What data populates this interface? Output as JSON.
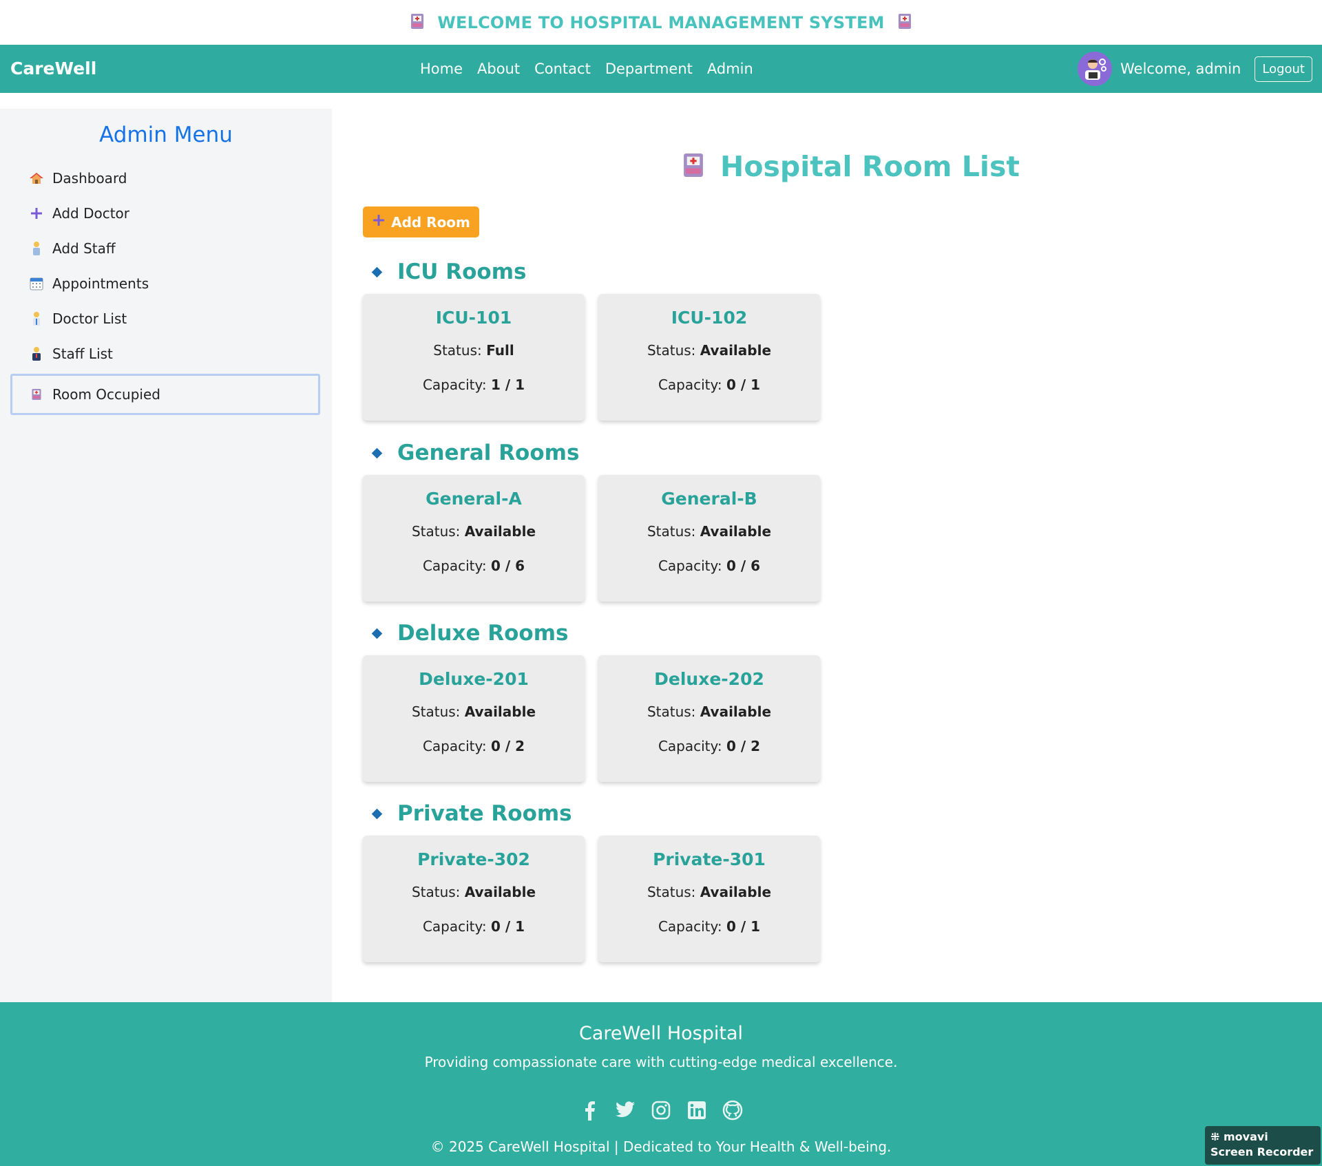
{
  "banner": {
    "text": "WELCOME TO HOSPITAL MANAGEMENT SYSTEM",
    "left_icon": "hospital-bed-icon",
    "right_icon": "hospital-bed-icon"
  },
  "navbar": {
    "brand": "CareWell",
    "links": [
      "Home",
      "About",
      "Contact",
      "Department",
      "Admin"
    ],
    "welcome": "Welcome, admin",
    "logout": "Logout"
  },
  "sidebar": {
    "title": "Admin Menu",
    "items": [
      {
        "label": "Dashboard",
        "icon": "house-icon"
      },
      {
        "label": "Add Doctor",
        "icon": "plus-icon"
      },
      {
        "label": "Add Staff",
        "icon": "person-icon"
      },
      {
        "label": "Appointments",
        "icon": "calendar-icon"
      },
      {
        "label": "Doctor List",
        "icon": "doctor-icon"
      },
      {
        "label": "Staff List",
        "icon": "staff-icon"
      },
      {
        "label": "Room Occupied",
        "icon": "hospital-bed-icon",
        "active": true
      }
    ]
  },
  "main": {
    "title": "Hospital Room List",
    "add_room": "Add Room",
    "status_label": "Status:",
    "capacity_label": "Capacity:",
    "sections": [
      {
        "title": "ICU Rooms",
        "rooms": [
          {
            "name": "ICU-101",
            "status": "Full",
            "capacity": "1 / 1"
          },
          {
            "name": "ICU-102",
            "status": "Available",
            "capacity": "0 / 1"
          }
        ]
      },
      {
        "title": "General Rooms",
        "rooms": [
          {
            "name": "General-A",
            "status": "Available",
            "capacity": "0 / 6"
          },
          {
            "name": "General-B",
            "status": "Available",
            "capacity": "0 / 6"
          }
        ]
      },
      {
        "title": "Deluxe Rooms",
        "rooms": [
          {
            "name": "Deluxe-201",
            "status": "Available",
            "capacity": "0 / 2"
          },
          {
            "name": "Deluxe-202",
            "status": "Available",
            "capacity": "0 / 2"
          }
        ]
      },
      {
        "title": "Private Rooms",
        "rooms": [
          {
            "name": "Private-302",
            "status": "Available",
            "capacity": "0 / 1"
          },
          {
            "name": "Private-301",
            "status": "Available",
            "capacity": "0 / 1"
          }
        ]
      }
    ]
  },
  "footer": {
    "title": "CareWell Hospital",
    "tagline": "Providing compassionate care with cutting-edge medical excellence.",
    "socials": [
      "facebook-icon",
      "twitter-icon",
      "instagram-icon",
      "linkedin-icon",
      "github-icon"
    ],
    "copyright": "© 2025 CareWell Hospital | Dedicated to Your Health & Well-being."
  },
  "watermark": {
    "line1": "movavi",
    "line2": "Screen Recorder"
  },
  "colors": {
    "primary": "#2fac9f",
    "accent": "#f9a221",
    "title": "#4cc3bf",
    "sidebar_title": "#1673e6"
  }
}
